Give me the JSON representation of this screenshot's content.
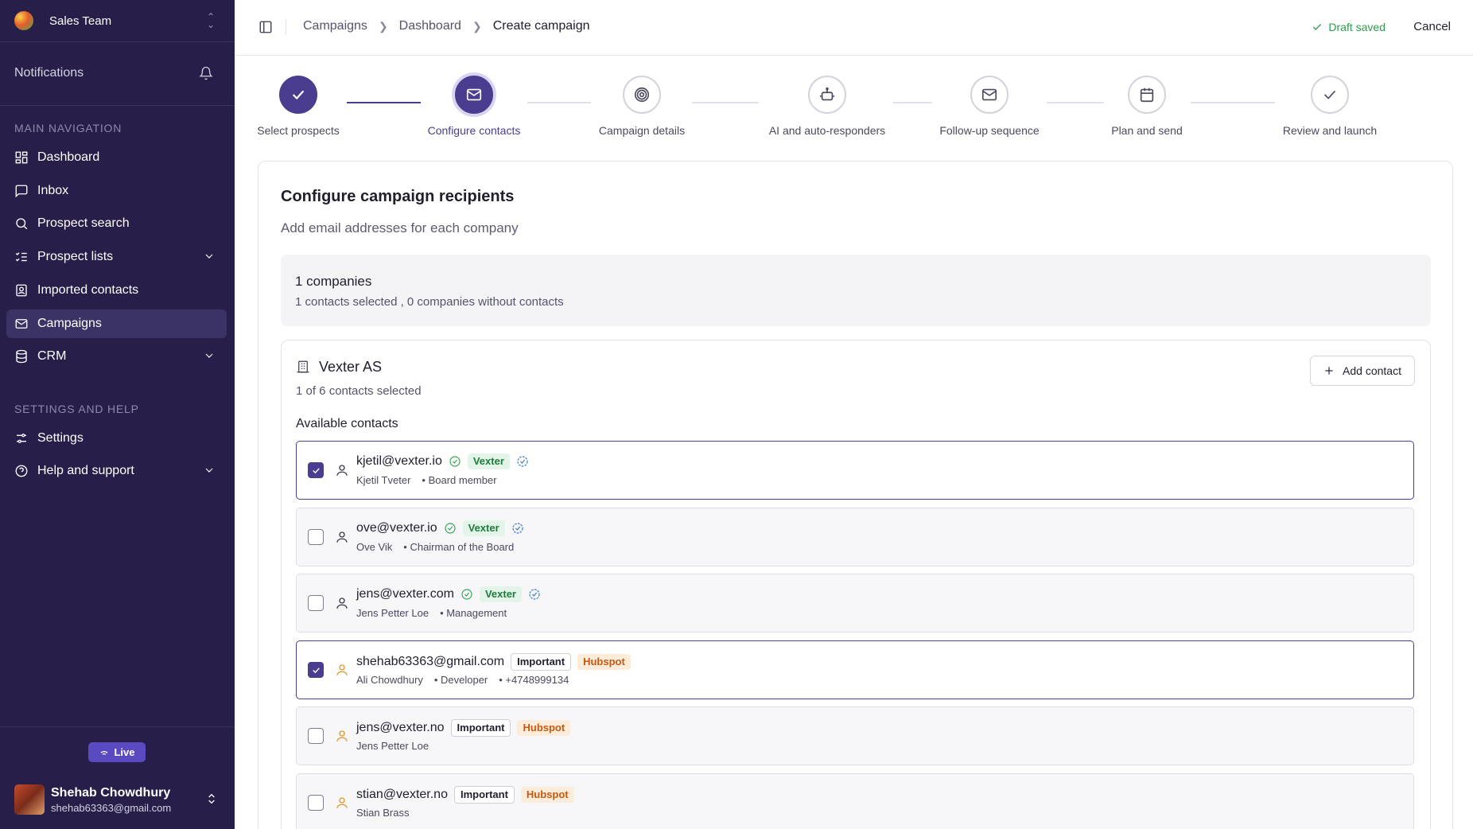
{
  "sidebar": {
    "team_name": "Sales Team",
    "notifications_label": "Notifications",
    "main_nav_label": "MAIN NAVIGATION",
    "main_items": [
      {
        "label": "Dashboard",
        "icon": "dashboard-icon"
      },
      {
        "label": "Inbox",
        "icon": "inbox-icon"
      },
      {
        "label": "Prospect search",
        "icon": "search-icon"
      },
      {
        "label": "Prospect lists",
        "icon": "list-icon"
      },
      {
        "label": "Imported contacts",
        "icon": "contacts-icon"
      },
      {
        "label": "Campaigns",
        "icon": "mail-icon",
        "active": true
      },
      {
        "label": "CRM",
        "icon": "database-icon"
      }
    ],
    "settings_label": "SETTINGS AND HELP",
    "settings_items": [
      {
        "label": "Settings",
        "icon": "settings-icon"
      },
      {
        "label": "Help and support",
        "icon": "help-icon"
      }
    ],
    "live_label": "Live",
    "user": {
      "name": "Shehab Chowdhury",
      "email": "shehab63363@gmail.com"
    }
  },
  "header": {
    "breadcrumbs": [
      "Campaigns",
      "Dashboard",
      "Create campaign"
    ],
    "draft_status": "Draft saved",
    "cancel_label": "Cancel",
    "status_color": "#2f9a4a"
  },
  "stepper": {
    "steps": [
      {
        "label": "Select prospects",
        "icon": "check-icon",
        "state": "done"
      },
      {
        "label": "Configure contacts",
        "icon": "mail-icon",
        "state": "current"
      },
      {
        "label": "Campaign details",
        "icon": "target-icon",
        "state": "pending"
      },
      {
        "label": "AI and auto-responders",
        "icon": "bot-icon",
        "state": "pending"
      },
      {
        "label": "Follow-up sequence",
        "icon": "mail-icon",
        "state": "pending"
      },
      {
        "label": "Plan and send",
        "icon": "calendar-icon",
        "state": "pending"
      },
      {
        "label": "Review and launch",
        "icon": "check-icon",
        "state": "pending"
      }
    ],
    "accent_color": "#4a3d8f"
  },
  "main": {
    "title": "Configure campaign recipients",
    "subtitle": "Add email addresses for each company",
    "summary": {
      "companies": "1 companies",
      "detail": "1 contacts selected , 0 companies without contacts"
    },
    "company": {
      "name": "Vexter AS",
      "selected_count": "1 of 6 contacts selected",
      "add_contact_label": "Add contact",
      "available_label": "Available contacts",
      "contacts": [
        {
          "email": "kjetil@vexter.io",
          "name": "Kjetil Tveter",
          "role": "• Board member",
          "phone": "",
          "checked": true,
          "tags": [
            "Vexter"
          ],
          "verified": true,
          "source": "vexter"
        },
        {
          "email": "ove@vexter.io",
          "name": "Ove Vik",
          "role": "• Chairman of the Board",
          "phone": "",
          "checked": false,
          "tags": [
            "Vexter"
          ],
          "verified": true,
          "source": "vexter"
        },
        {
          "email": "jens@vexter.com",
          "name": "Jens Petter Loe",
          "role": "• Management",
          "phone": "",
          "checked": false,
          "tags": [
            "Vexter"
          ],
          "verified": true,
          "source": "vexter"
        },
        {
          "email": "shehab63363@gmail.com",
          "name": "Ali Chowdhury",
          "role": "• Developer",
          "phone": "• +4748999134",
          "checked": true,
          "tags": [
            "Important",
            "Hubspot"
          ],
          "verified": false,
          "source": "hubspot"
        },
        {
          "email": "jens@vexter.no",
          "name": "Jens Petter Loe",
          "role": "",
          "phone": "",
          "checked": false,
          "tags": [
            "Important",
            "Hubspot"
          ],
          "verified": false,
          "source": "hubspot"
        },
        {
          "email": "stian@vexter.no",
          "name": "Stian Brass",
          "role": "",
          "phone": "",
          "checked": false,
          "tags": [
            "Important",
            "Hubspot"
          ],
          "verified": false,
          "source": "hubspot"
        }
      ]
    }
  }
}
